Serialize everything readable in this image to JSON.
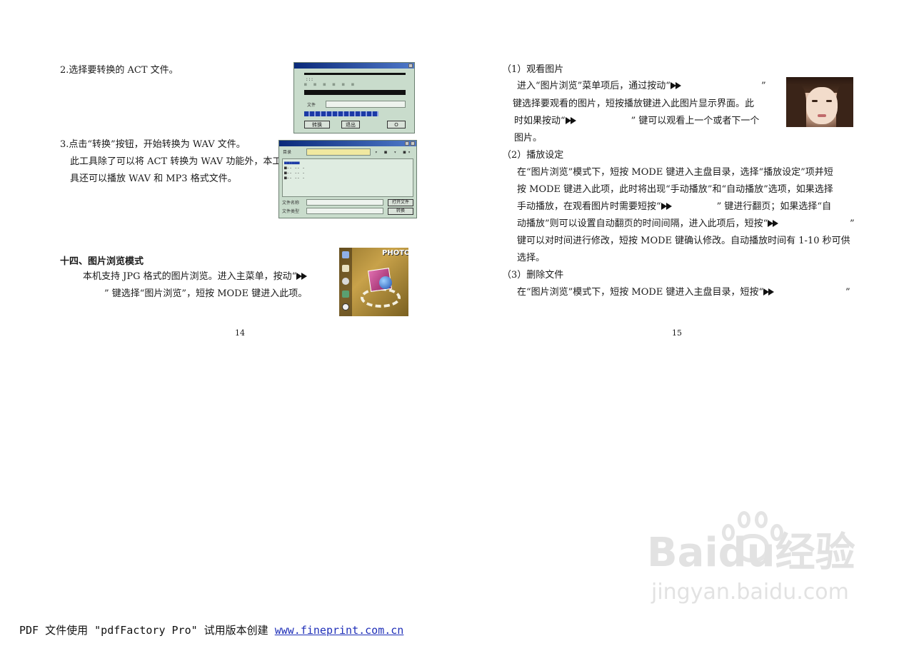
{
  "left_page": {
    "step2": "2.选择要转换的 ACT 文件。",
    "step3_line1": "3.点击“转换”按钮，开始转换为 WAV 文件。",
    "step3_line2": "此工具除了可以将 ACT 转换为 WAV 功能外，本工",
    "step3_line3": "具还可以播放 WAV 和 MP3 格式文件。",
    "section_title": "十四、图片浏览模式",
    "section_line1": "本机支持 JPG 格式的图片浏览。进入主菜单，按动“",
    "section_line2": "” 键选择“图片浏览”，短按 MODE 键进入此项。",
    "page_number": "14",
    "menu_badge": "PHOTO"
  },
  "right_page": {
    "view_title": "（1）观看图片",
    "view_line1": "进入“图片浏览”菜单项后，通过按动“",
    "view_line1_end": "”",
    "view_line2": "键选择要观看的图片，短按播放键进入此图片显示界面。此",
    "view_line3a": "时如果按动“",
    "view_line3b": "” 键可以观看上一个或者下一个",
    "view_line4": "图片。",
    "play_title": "（2）播放设定",
    "play_line1": "在“图片浏览”模式下，短按 MODE 键进入主盘目录，选择“播放设定”项并短",
    "play_line2": "按 MODE 键进入此项，此时将出现“手动播放”和“自动播放”选项，如果选择",
    "play_line3a": "手动播放，在观看图片时需要短按“",
    "play_line3b": "” 键进行翻页；如果选择“自",
    "play_line4a": "动播放”则可以设置自动翻页的时间间隔，进入此项后，短按“",
    "play_line4b": "”",
    "play_line5": "键可以对时间进行修改，短按 MODE 键确认修改。自动播放时间有 1-10 秒可供",
    "play_line6": "选择。",
    "delete_title": "（3）删除文件",
    "delete_line1": "在“图片浏览”模式下，短按 MODE 键进入主盘目录，短按“",
    "delete_line1_end": "”",
    "page_number": "15"
  },
  "footer": {
    "prefix": "PDF 文件使用 \"pdfFactory Pro\" 试用版本创建 ",
    "link": "www.fineprint.com.cn"
  },
  "watermark": {
    "brand": "Baidu经验",
    "url": "jingyan.baidu.com"
  },
  "dialog1": {
    "ok": "转换",
    "cancel": "退出"
  },
  "dialog2": {
    "button1": "打开文件",
    "button2": "转换"
  },
  "colors": {
    "dialog_bg": "#c9dccc",
    "titlebar": "#0a2a7a",
    "link": "#1f2fb8",
    "watermark": "#e2e2e2"
  }
}
